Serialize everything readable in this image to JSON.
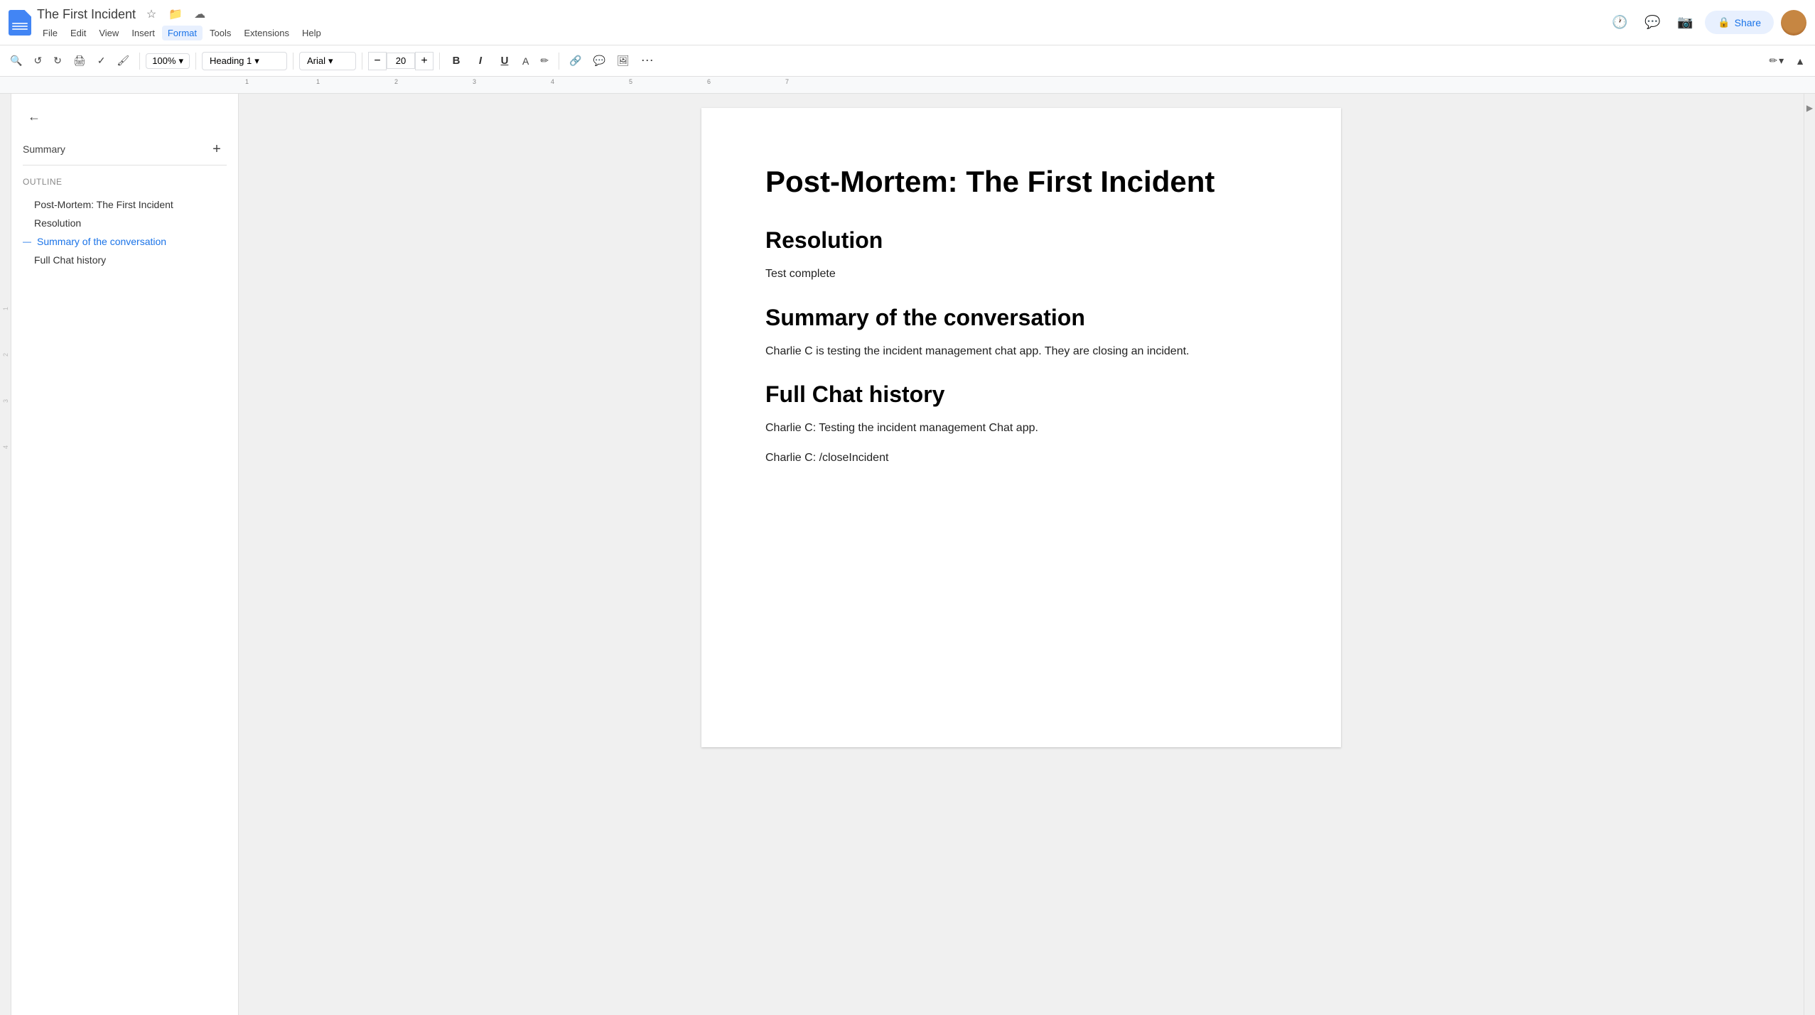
{
  "app": {
    "title": "The First Incident",
    "icon": "doc-icon"
  },
  "topbar": {
    "title": "The First Incident",
    "menu_items": [
      "File",
      "Edit",
      "View",
      "Insert",
      "Format",
      "Tools",
      "Extensions",
      "Help"
    ],
    "active_menu": "Format",
    "share_label": "Share"
  },
  "toolbar": {
    "zoom": "100%",
    "style": "Heading 1",
    "font": "Arial",
    "font_size": "20",
    "bold_label": "B",
    "italic_label": "I",
    "underline_label": "U"
  },
  "sidebar": {
    "summary_label": "Summary",
    "outline_label": "Outline",
    "back_icon": "←",
    "add_icon": "+",
    "outline_items": [
      {
        "label": "Post-Mortem: The First Incident",
        "active": false
      },
      {
        "label": "Resolution",
        "active": false
      },
      {
        "label": "Summary of the conversation",
        "active": true
      },
      {
        "label": "Full Chat history",
        "active": false
      }
    ]
  },
  "document": {
    "main_title": "Post-Mortem: The First Incident",
    "sections": [
      {
        "heading": "Resolution",
        "body_lines": [
          "Test complete"
        ]
      },
      {
        "heading": "Summary of the conversation",
        "body_lines": [
          "Charlie C is testing the incident management chat app. They are closing an incident."
        ]
      },
      {
        "heading": "Full Chat history",
        "body_lines": [
          "Charlie C: Testing the incident management Chat app.",
          "Charlie C: /closeIncident"
        ]
      }
    ]
  },
  "icons": {
    "search": "🔍",
    "undo": "↺",
    "redo": "↻",
    "print": "🖨",
    "spellcheck": "✓",
    "format_paint": "🖌",
    "chevron_down": "▾",
    "minus": "−",
    "plus": "+",
    "bold": "B",
    "italic": "I",
    "underline": "U",
    "text_color": "A",
    "highlight": "✏",
    "link": "🔗",
    "comment": "💬",
    "image": "🖼",
    "more": "⋯",
    "edit_pencil": "✏",
    "chevron_up": "▲",
    "history": "🕐",
    "chat": "💬",
    "camera": "📷",
    "lock": "🔒",
    "back": "←"
  }
}
